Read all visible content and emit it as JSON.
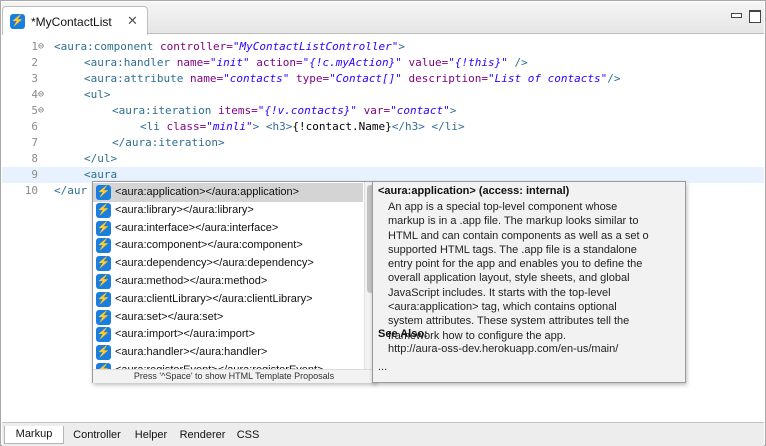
{
  "editor": {
    "tab_title": "*MyContactList",
    "tab_close": "✕",
    "tab_icon_glyph": "⚡",
    "tab_icon_color": "#1a7de0"
  },
  "code_lines": [
    {
      "num": "1",
      "fold": "⊖"
    },
    {
      "num": "2",
      "fold": ""
    },
    {
      "num": "3",
      "fold": ""
    },
    {
      "num": "4",
      "fold": "⊖"
    },
    {
      "num": "5",
      "fold": "⊖"
    },
    {
      "num": "6",
      "fold": ""
    },
    {
      "num": "7",
      "fold": ""
    },
    {
      "num": "8",
      "fold": ""
    },
    {
      "num": "9",
      "fold": ""
    },
    {
      "num": "10",
      "fold": ""
    }
  ],
  "code": {
    "l1": {
      "open": "<aura:component ",
      "attr": "controller=",
      "val": "\"MyContactListController\"",
      "close": ">"
    },
    "l2": {
      "open": "<aura:handler ",
      "a1": "name=",
      "v1": "\"init\"",
      "a2": " action=",
      "v2": "\"{!c.myAction}\"",
      "a3": " value=",
      "v3": "\"{!this}\"",
      "close": " />"
    },
    "l3": {
      "open": "<aura:attribute ",
      "a1": "name=",
      "v1": "\"contacts\"",
      "a2": " type=",
      "v2": "\"Contact[]\"",
      "a3": " description=",
      "v3": "\"List of contacts\"",
      "close": "/>"
    },
    "l4": {
      "tag": "<ul>"
    },
    "l5": {
      "open": "<aura:iteration ",
      "a1": "items=",
      "v1": "\"{!v.contacts}\"",
      "a2": " var=",
      "v2": "\"contact\"",
      "close": ">"
    },
    "l6": {
      "open": "<li ",
      "a1": "class=",
      "v1": "\"minli\"",
      "mid": "> ",
      "h3o": "<h3>",
      "text": "{!contact.Name}",
      "h3c": "</h3>",
      "liend": " </li>"
    },
    "l7": {
      "tag": "</aura:iteration>"
    },
    "l8": {
      "tag": "</ul>"
    },
    "l9": {
      "tag": "<aura"
    },
    "l10": {
      "tag": "</aur"
    }
  },
  "assist": {
    "items": [
      "<aura:application></aura:application>",
      "<aura:library></aura:library>",
      "<aura:interface></aura:interface>",
      "<aura:component></aura:component>",
      "<aura:dependency></aura:dependency>",
      "<aura:method></aura:method>",
      "<aura:clientLibrary></aura:clientLibrary>",
      "<aura:set></aura:set>",
      "<aura:import></aura:import>",
      "<aura:handler></aura:handler>",
      "<aura:registerEvent></aura:registerEvent>"
    ],
    "selected_index": 0,
    "status_hint": "Press '^Space' to show HTML Template Proposals"
  },
  "doc": {
    "title": "<aura:application> (access: internal)",
    "body": "An app is a special top-level component whose\nmarkup is in a .app file. The markup looks similar to\nHTML and can contain components as well as a set o\nsupported HTML tags. The .app file is a standalone\nentry point for the app and enables you to define the\noverall application layout, style sheets, and global\nJavaScript includes. It starts with the top-level\n<aura:application> tag, which contains optional\nsystem attributes. These system attributes tell the\nframework how to configure the app.",
    "see_also_label": "See Also:",
    "url": "http://aura-oss-dev.herokuapp.com/en-us/main/",
    "ellipsis": "..."
  },
  "bottom_tabs": [
    "Markup",
    "Controller",
    "Helper",
    "Renderer",
    "CSS"
  ],
  "active_bottom_tab": "Markup"
}
